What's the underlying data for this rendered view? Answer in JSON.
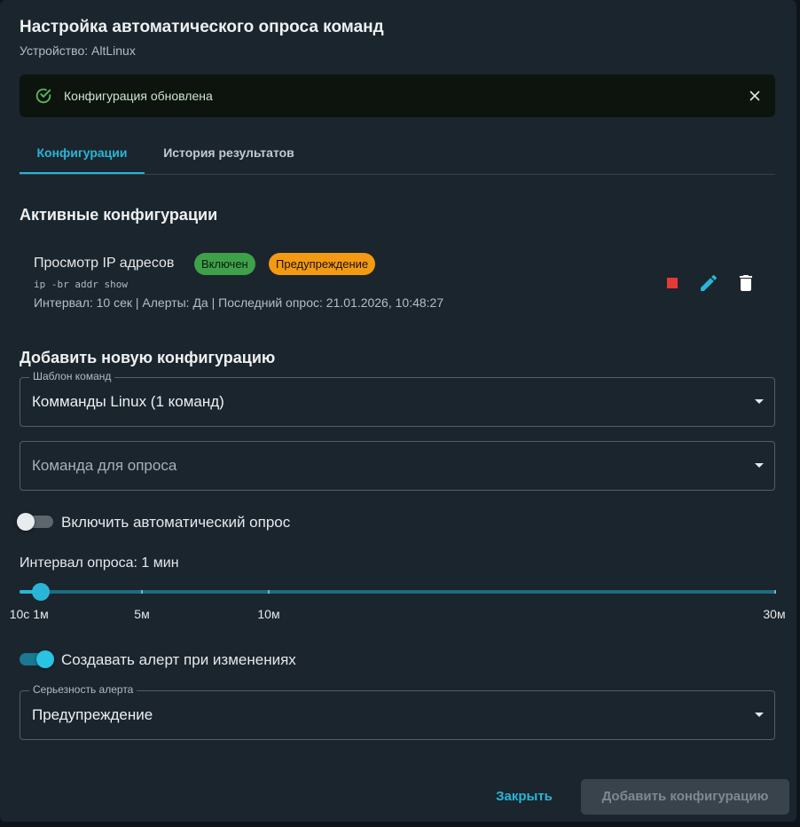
{
  "header": {
    "title": "Настройка автоматического опроса команд",
    "subtitle": "Устройство: AltLinux"
  },
  "notification": {
    "text": "Конфигурация обновлена",
    "color": "#0c140d"
  },
  "tabs": [
    {
      "label": "Конфигурации",
      "active": true
    },
    {
      "label": "История результатов",
      "active": false
    }
  ],
  "active_configs": {
    "heading": "Активные конфигурации",
    "items": [
      {
        "name": "Просмотр IP адресов",
        "status_badge": "Включен",
        "severity_badge": "Предупреждение",
        "command": "ip -br addr show",
        "meta": "Интервал: 10 сек | Алерты: Да | Последний опрос: 21.01.2026, 10:48:27"
      }
    ]
  },
  "add_form": {
    "heading": "Добавить новую конфигурацию",
    "template": {
      "label": "Шаблон команд",
      "value": "Комманды Linux (1 команд)"
    },
    "command": {
      "placeholder": "Команда для опроса"
    },
    "auto_poll": {
      "label": "Включить автоматический опрос",
      "enabled": false
    },
    "interval": {
      "label": "Интервал опроса: 1 мин",
      "value_seconds": 60,
      "marks": [
        "10с",
        "1м",
        "5м",
        "10м",
        "30м"
      ]
    },
    "alert_toggle": {
      "label": "Создавать алерт при изменениях",
      "enabled": true
    },
    "severity": {
      "label": "Серьезность алерта",
      "value": "Предупреждение"
    }
  },
  "footer": {
    "close_label": "Закрыть",
    "add_label": "Добавить конфигурацию"
  },
  "colors": {
    "accent": "#29b6d6",
    "success": "#3ea14a",
    "warning": "#f39a12",
    "stop": "#e53935"
  }
}
